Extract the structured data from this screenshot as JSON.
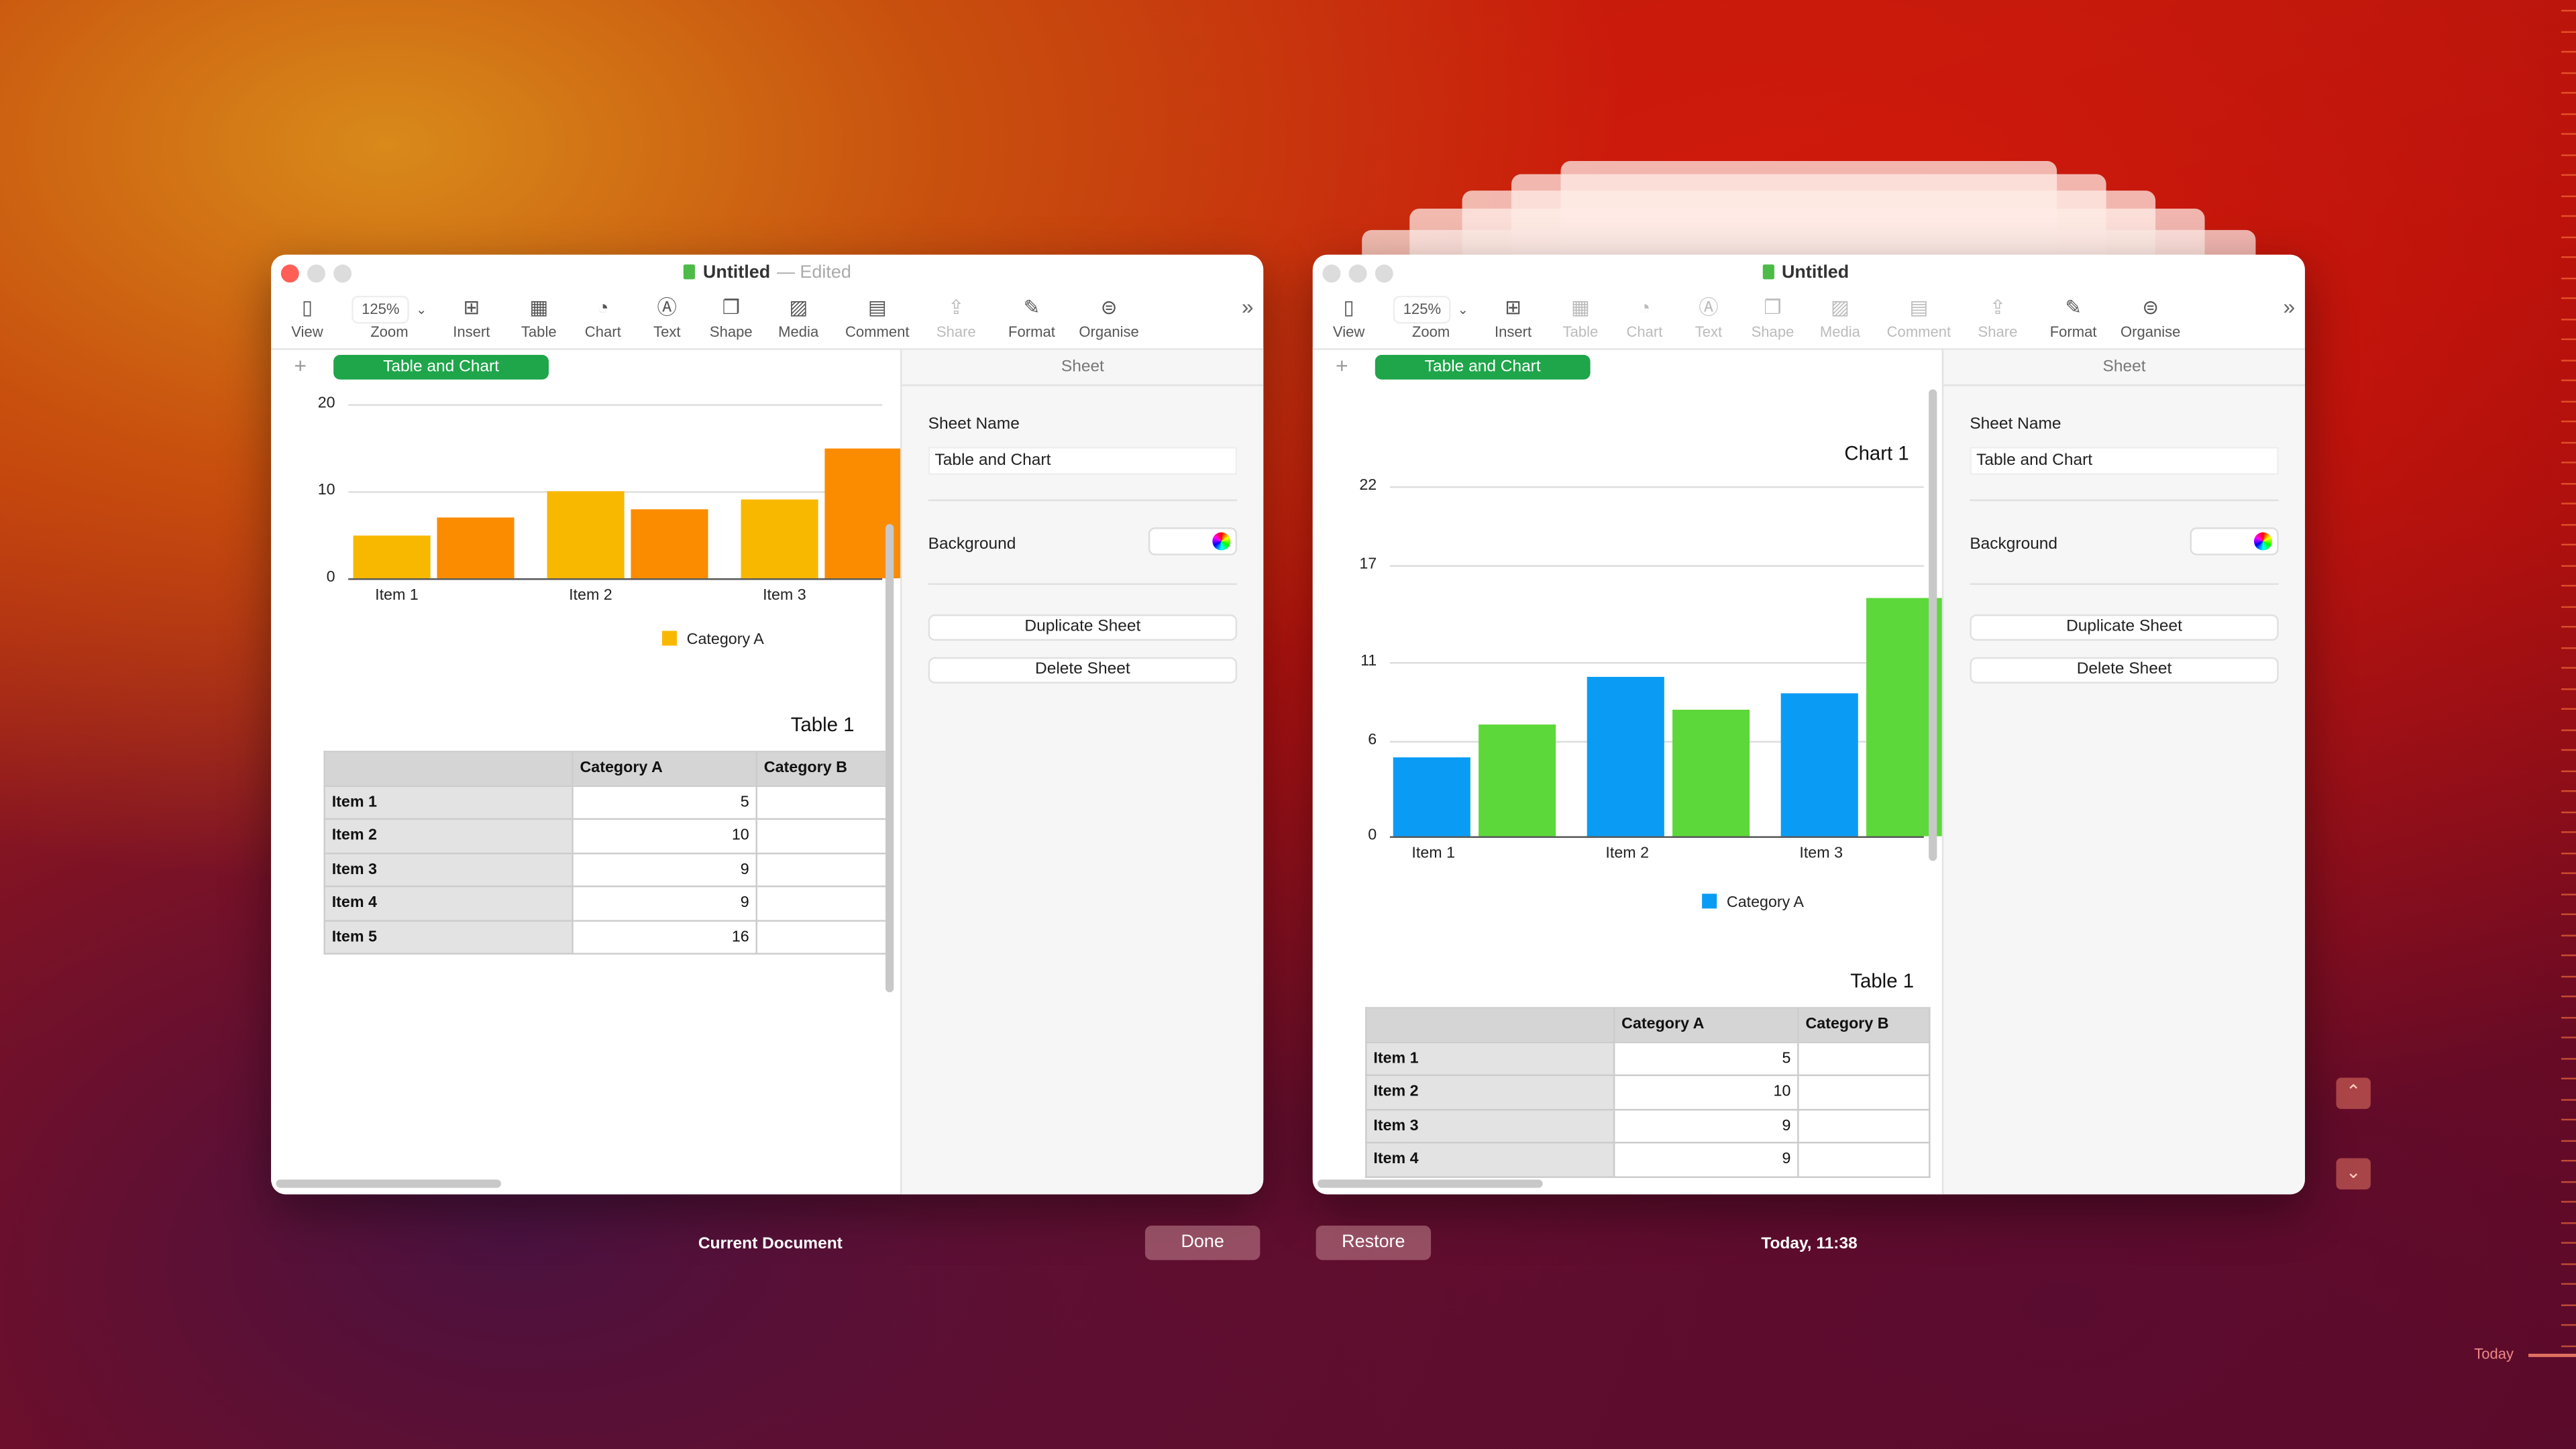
{
  "windows": [
    {
      "title": "Untitled",
      "edited": "— Edited",
      "zoom": "125%",
      "toolbar": [
        "View",
        "Zoom",
        "Insert",
        "Table",
        "Chart",
        "Text",
        "Shape",
        "Media",
        "Comment",
        "Share",
        "Format",
        "Organise"
      ],
      "sheet_tab": "Table and Chart",
      "sidebar": {
        "header": "Sheet",
        "sheet_name_label": "Sheet Name",
        "sheet_name_value": "Table and Chart",
        "background_label": "Background",
        "duplicate": "Duplicate Sheet",
        "delete": "Delete Sheet"
      },
      "chart_title": "",
      "table_title": "Table 1"
    },
    {
      "title": "Untitled",
      "edited": "",
      "zoom": "125%",
      "toolbar": [
        "View",
        "Zoom",
        "Insert",
        "Table",
        "Chart",
        "Text",
        "Shape",
        "Media",
        "Comment",
        "Share",
        "Format",
        "Organise"
      ],
      "sheet_tab": "Table and Chart",
      "sidebar": {
        "header": "Sheet",
        "sheet_name_label": "Sheet Name",
        "sheet_name_value": "Table and Chart",
        "background_label": "Background",
        "duplicate": "Duplicate Sheet",
        "delete": "Delete Sheet"
      },
      "chart_title": "Chart 1",
      "table_title": "Table 1"
    }
  ],
  "table": {
    "headers": [
      "",
      "Category A",
      "Category B"
    ],
    "rows": [
      [
        "Item 1",
        "5",
        ""
      ],
      [
        "Item 2",
        "10",
        ""
      ],
      [
        "Item 3",
        "9",
        ""
      ],
      [
        "Item 4",
        "9",
        ""
      ],
      [
        "Item 5",
        "16",
        ""
      ]
    ]
  },
  "chart_data": [
    {
      "type": "bar",
      "title": "",
      "categories": [
        "Item 1",
        "Item 2",
        "Item 3"
      ],
      "series": [
        {
          "name": "Category A",
          "values": [
            5,
            10,
            9
          ],
          "color": "#f8b800"
        },
        {
          "values": [
            7,
            8,
            15
          ],
          "color": "#fb8c00"
        }
      ],
      "yticks": [
        0,
        10,
        20
      ],
      "ylim": [
        0,
        20
      ],
      "legend": "bottom",
      "grid": true
    },
    {
      "type": "bar",
      "title": "Chart 1",
      "categories": [
        "Item 1",
        "Item 2",
        "Item 3"
      ],
      "series": [
        {
          "name": "Category A",
          "values": [
            5,
            10,
            9
          ],
          "color": "#0a9cf5"
        },
        {
          "values": [
            7,
            8,
            15
          ],
          "color": "#5dd83a"
        }
      ],
      "yticks": [
        0,
        6,
        11,
        17,
        22
      ],
      "ylim": [
        0,
        22
      ],
      "legend": "bottom",
      "grid": true
    }
  ],
  "footer": {
    "current": "Current Document",
    "done": "Done",
    "restore": "Restore",
    "time": "Today, 11:38",
    "timeline_today": "Today"
  },
  "icons": {
    "up": "chevron-up-icon",
    "down": "chevron-down-icon"
  }
}
